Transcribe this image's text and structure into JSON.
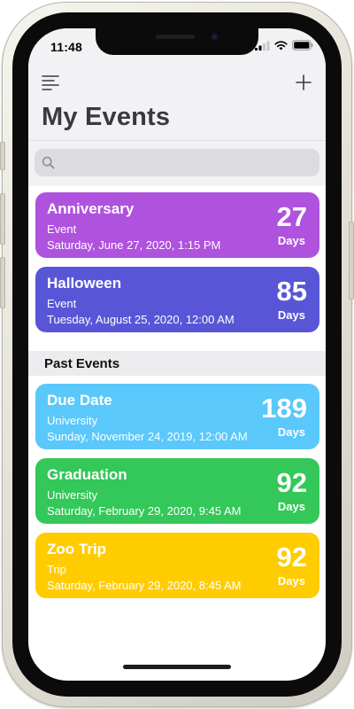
{
  "status_bar": {
    "time": "11:48"
  },
  "nav": {
    "menu_icon": "menu-lines-icon",
    "add_icon": "plus-icon",
    "title": "My Events"
  },
  "search": {
    "placeholder": "",
    "value": "",
    "icon": "search-icon"
  },
  "upcoming_events": [
    {
      "title": "Anniversary",
      "category": "Event",
      "date": "Saturday, June 27, 2020, 1:15 PM",
      "count": "27",
      "unit": "Days",
      "color": "#af52de"
    },
    {
      "title": "Halloween",
      "category": "Event",
      "date": "Tuesday, August 25, 2020, 12:00 AM",
      "count": "85",
      "unit": "Days",
      "color": "#5856d6"
    }
  ],
  "past_section": {
    "header": "Past Events"
  },
  "past_events": [
    {
      "title": "Due Date",
      "category": "University",
      "date": "Sunday, November 24, 2019, 12:00 AM",
      "count": "189",
      "unit": "Days",
      "color": "#5ac8fa"
    },
    {
      "title": "Graduation",
      "category": "University",
      "date": "Saturday, February 29, 2020, 9:45 AM",
      "count": "92",
      "unit": "Days",
      "color": "#34c759"
    },
    {
      "title": "Zoo Trip",
      "category": "Trip",
      "date": "Saturday, February 29, 2020, 8:45 AM",
      "count": "92",
      "unit": "Days",
      "color": "#ffcc00"
    }
  ]
}
